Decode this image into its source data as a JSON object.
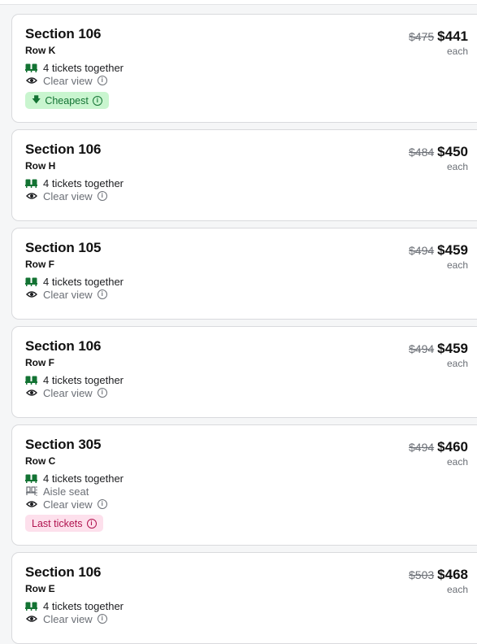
{
  "listings": [
    {
      "section": "Section 106",
      "row": "Row K",
      "old_price": "$475",
      "price": "$441",
      "each": "each",
      "tickets": "4 tickets together",
      "aisle": null,
      "view": "Clear view",
      "badge": {
        "label": "Cheapest",
        "tone": "green",
        "icon": "arrow-down-icon"
      }
    },
    {
      "section": "Section 106",
      "row": "Row H",
      "old_price": "$484",
      "price": "$450",
      "each": "each",
      "tickets": "4 tickets together",
      "aisle": null,
      "view": "Clear view",
      "badge": null
    },
    {
      "section": "Section 105",
      "row": "Row F",
      "old_price": "$494",
      "price": "$459",
      "each": "each",
      "tickets": "4 tickets together",
      "aisle": null,
      "view": "Clear view",
      "badge": null
    },
    {
      "section": "Section 106",
      "row": "Row F",
      "old_price": "$494",
      "price": "$459",
      "each": "each",
      "tickets": "4 tickets together",
      "aisle": null,
      "view": "Clear view",
      "badge": null
    },
    {
      "section": "Section 305",
      "row": "Row C",
      "old_price": "$494",
      "price": "$460",
      "each": "each",
      "tickets": "4 tickets together",
      "aisle": "Aisle seat",
      "view": "Clear view",
      "badge": {
        "label": "Last tickets",
        "tone": "pink",
        "icon": null
      }
    },
    {
      "section": "Section 106",
      "row": "Row E",
      "old_price": "$503",
      "price": "$468",
      "each": "each",
      "tickets": "4 tickets together",
      "aisle": null,
      "view": "Clear view",
      "badge": null
    }
  ],
  "colors": {
    "green_badge_bg": "#c9f5cf",
    "green_badge_text": "#137333",
    "pink_badge_bg": "#fde0ec",
    "pink_badge_text": "#b0134f",
    "seat_icon": "#137333"
  }
}
